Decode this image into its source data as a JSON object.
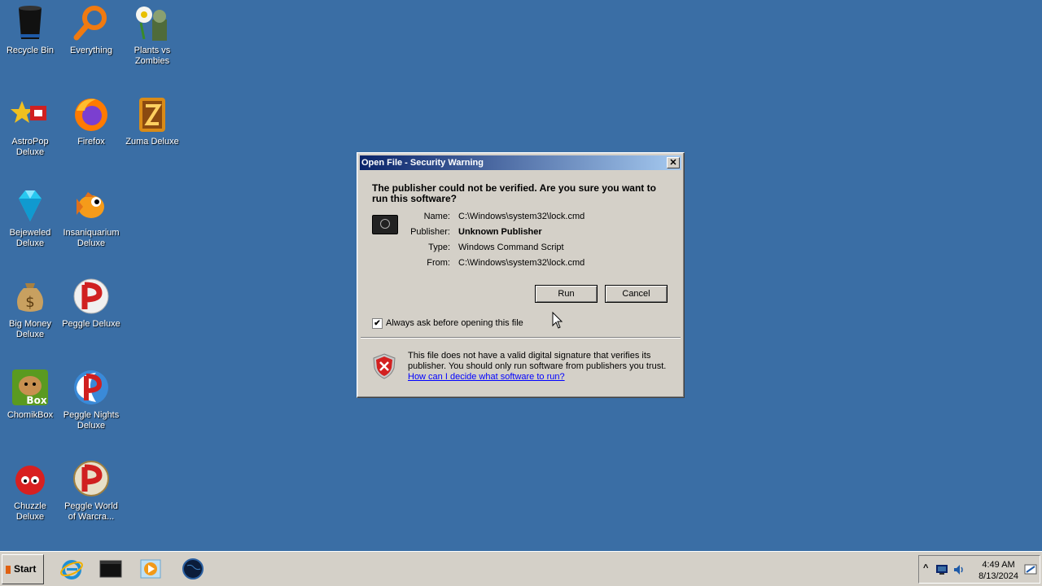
{
  "desktop": {
    "icons": [
      {
        "label": "Recycle Bin",
        "icon": "recycle-bin-icon"
      },
      {
        "label": "Everything",
        "icon": "magnifier-icon"
      },
      {
        "label": "Plants vs Zombies",
        "icon": "plants-vs-zombies-icon"
      },
      {
        "label": "AstroPop Deluxe",
        "icon": "astropop-icon"
      },
      {
        "label": "Firefox",
        "icon": "firefox-icon"
      },
      {
        "label": "Zuma Deluxe",
        "icon": "zuma-icon"
      },
      {
        "label": "Bejeweled Deluxe",
        "icon": "diamond-icon"
      },
      {
        "label": "Insaniquarium Deluxe",
        "icon": "fish-icon"
      },
      {
        "label": "Big Money Deluxe",
        "icon": "money-bag-icon"
      },
      {
        "label": "Peggle Deluxe",
        "icon": "peggle-icon"
      },
      {
        "label": "ChomikBox",
        "icon": "hamster-icon"
      },
      {
        "label": "Peggle Nights Deluxe",
        "icon": "peggle-nights-icon"
      },
      {
        "label": "Chuzzle Deluxe",
        "icon": "chuzzle-icon"
      },
      {
        "label": "Peggle World of Warcra...",
        "icon": "peggle-wow-icon"
      }
    ]
  },
  "dialog": {
    "title": "Open File - Security Warning",
    "close_label": "✕",
    "question": "The publisher could not be verified.  Are you sure you want to run this software?",
    "fields": [
      {
        "key": "Name:",
        "value": "C:\\Windows\\system32\\lock.cmd"
      },
      {
        "key": "Publisher:",
        "value": "Unknown Publisher"
      },
      {
        "key": "Type:",
        "value": "Windows Command Script"
      },
      {
        "key": "From:",
        "value": "C:\\Windows\\system32\\lock.cmd"
      }
    ],
    "run_label": "Run",
    "cancel_label": "Cancel",
    "checkbox_checked": true,
    "checkbox_mark": "✔",
    "checkbox_label": "Always ask before opening this file",
    "warning_text": "This file does not have a valid digital signature that verifies its publisher.  You should only run software from publishers you trust.",
    "help_link": "How can I decide what software to run?"
  },
  "taskbar": {
    "start_label": "Start",
    "pinned": [
      "internet-explorer-icon",
      "terminal-icon",
      "media-player-icon",
      "earth-icon"
    ],
    "tray": {
      "time": "4:49 AM",
      "date": "8/13/2024",
      "chevron": "^"
    }
  }
}
